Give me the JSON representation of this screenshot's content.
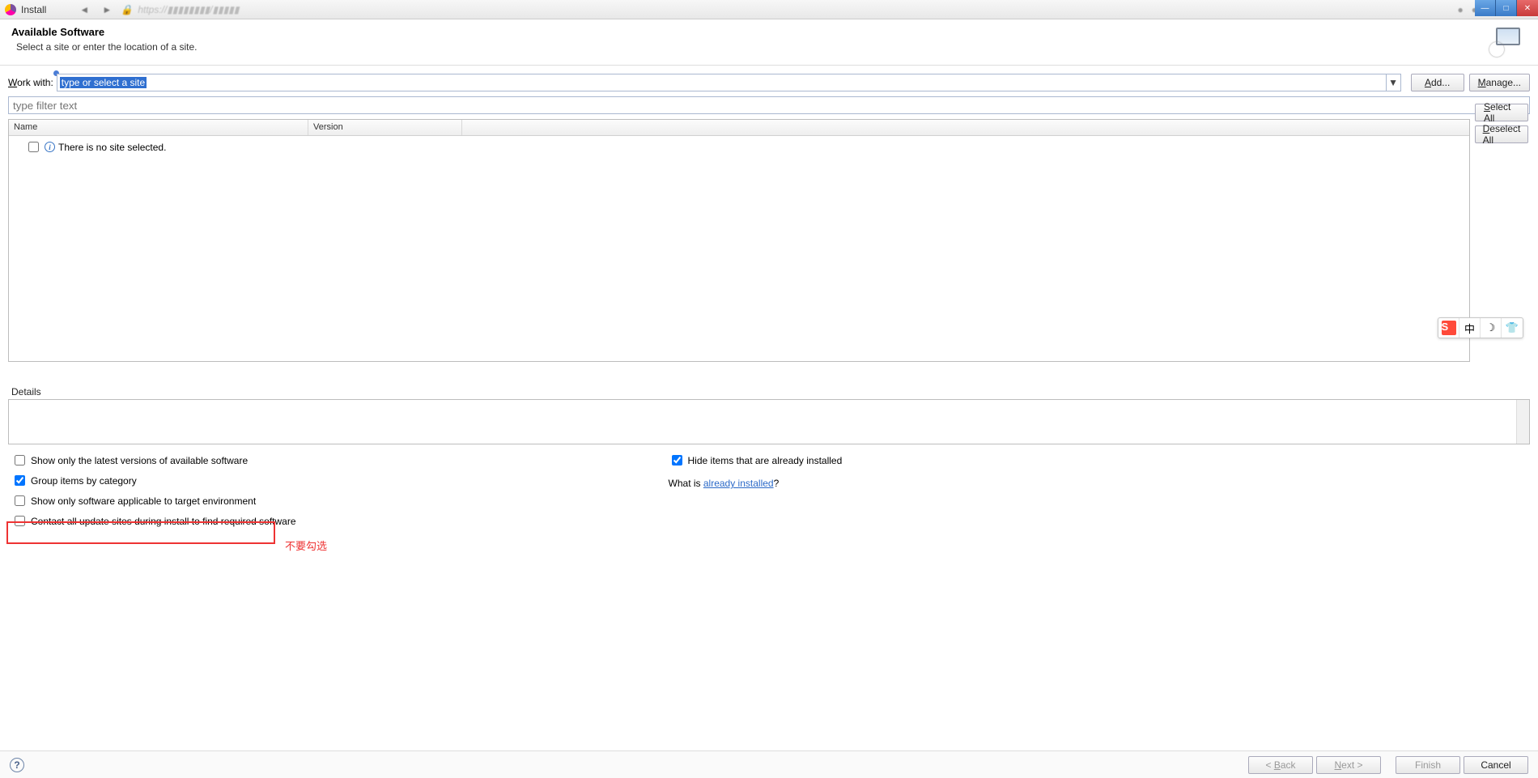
{
  "window": {
    "title": "Install"
  },
  "header": {
    "title": "Available Software",
    "subtitle": "Select a site or enter the location of a site."
  },
  "workWith": {
    "label": "Work with:",
    "selectedText": "type or select a site",
    "addBtn": "Add...",
    "manageBtn": "Manage..."
  },
  "filter": {
    "placeholder": "type filter text"
  },
  "tree": {
    "columns": {
      "name": "Name",
      "version": "Version"
    },
    "emptyRow": "There is no site selected."
  },
  "sideButtons": {
    "selectAll": "Select All",
    "deselectAll": "Deselect All"
  },
  "details": {
    "label": "Details"
  },
  "options": {
    "latestOnly": {
      "label": "Show only the latest versions of available software",
      "checked": false
    },
    "groupByCat": {
      "label": "Group items by category",
      "checked": true
    },
    "applicable": {
      "label": "Show only software applicable to target environment",
      "checked": false
    },
    "contactSites": {
      "label": "Contact all update sites during install to find required software",
      "checked": false
    },
    "hideInstalled": {
      "label": "Hide items that are already installed",
      "checked": true
    },
    "whatIsPrefix": "What is ",
    "whatIsLink": "already installed",
    "whatIsSuffix": "?"
  },
  "annotation": {
    "text": "不要勾选"
  },
  "wizard": {
    "back": "< Back",
    "next": "Next >",
    "finish": "Finish",
    "cancel": "Cancel"
  },
  "ime": {
    "s": "S",
    "cn": "中",
    "moon": "☽",
    "shirt": "👕"
  }
}
